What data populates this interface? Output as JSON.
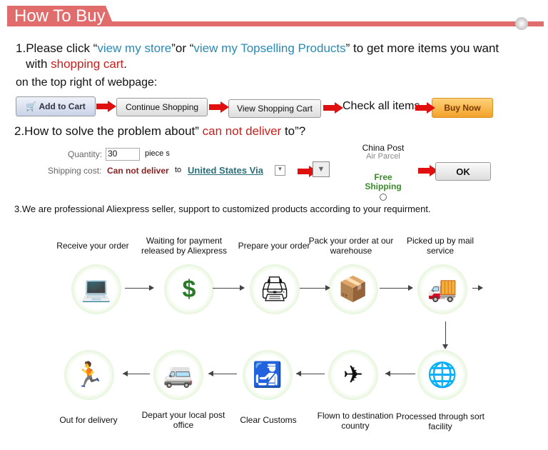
{
  "header": {
    "title": "How To Buy"
  },
  "step1": {
    "num": "1.",
    "t1": "Please click “",
    "link1": "view my store",
    "t2": "”or “",
    "link2": "view my Topselling Products",
    "t3": "” to get  more items you want",
    "t4": "with ",
    "cart": "shopping cart",
    "t5": ".",
    "note": "on the top right of webpage:"
  },
  "flow": {
    "add_to_cart": "Add to Cart",
    "continue": "Continue Shopping",
    "view_cart": "View Shopping Cart",
    "check": "Check all items",
    "buy_now": "Buy Now"
  },
  "step2": {
    "t1": "2.How to solve the problem about” ",
    "red": "can not deliver",
    "t2": " to”?",
    "quantity_label": "Quantity:",
    "quantity_value": "30",
    "unit": "piece s",
    "shipping_label": "Shipping cost:",
    "cannot": "Can not deliver",
    "to": "to",
    "country": "United States Via",
    "carrier": "China Post",
    "carrier_sub": "Air Parcel",
    "free": "Free Shipping",
    "ok": "OK"
  },
  "step3": {
    "text": "3.We are professional Aliexpress seller, support to customized products according to your requirment."
  },
  "process": [
    {
      "label": "Receive your order",
      "icon": "computer-user-icon"
    },
    {
      "label": "Waiting for payment released by Aliexpress",
      "icon": "money-bag-icon"
    },
    {
      "label": "Prepare your order",
      "icon": "printer-icon"
    },
    {
      "label": "Pack your order at our warehouse",
      "icon": "worker-boxes-icon"
    },
    {
      "label": "Picked up by mail service",
      "icon": "truck-icon"
    },
    {
      "label": "Processed through sort facility",
      "icon": "globe-mail-icon"
    },
    {
      "label": "Flown to destination country",
      "icon": "airplane-icon"
    },
    {
      "label": "Clear Customs",
      "icon": "customs-icon"
    },
    {
      "label": "Depart your local post office",
      "icon": "van-icon"
    },
    {
      "label": "Out for delivery",
      "icon": "courier-icon"
    }
  ],
  "colors": {
    "header": "#e06c6c",
    "link": "#2a8ab5",
    "red": "#c8201c",
    "arrow": "#e01010",
    "circle": "#b9e39a"
  }
}
